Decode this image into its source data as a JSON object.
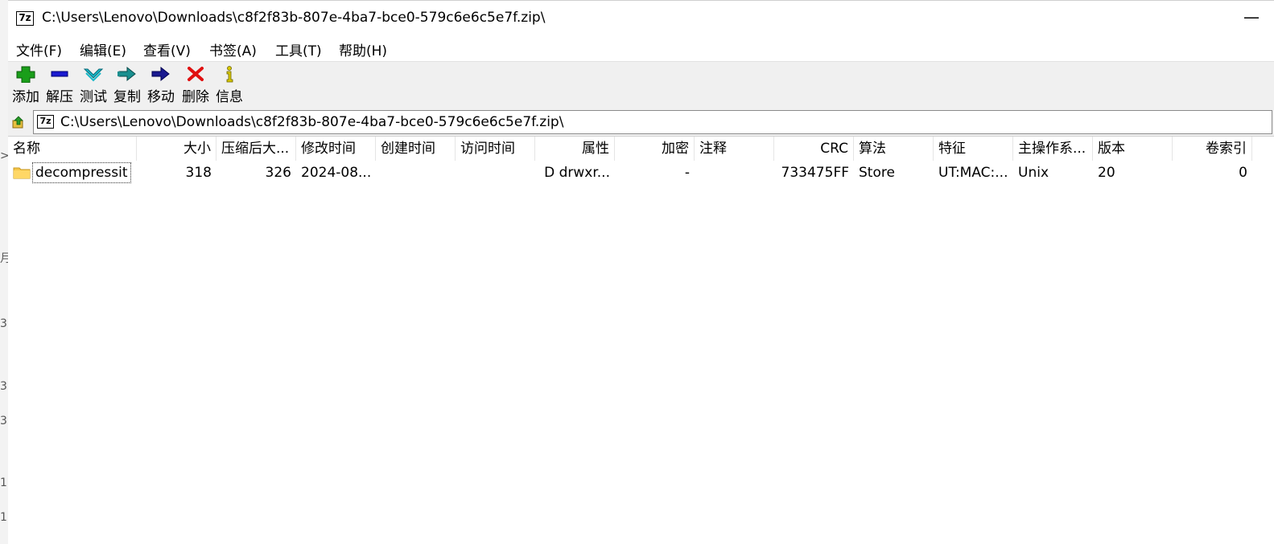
{
  "window": {
    "title": "C:\\Users\\Lenovo\\Downloads\\c8f2f83b-807e-4ba7-bce0-579c6e6c5e7f.zip\\",
    "app_icon_text": "7z",
    "minimize_glyph": "—"
  },
  "menu": [
    "文件(F)",
    "编辑(E)",
    "查看(V)",
    "书签(A)",
    "工具(T)",
    "帮助(H)"
  ],
  "toolbar": [
    {
      "label": "添加",
      "icon": "add-icon",
      "color": "#1a9e1a"
    },
    {
      "label": "解压",
      "icon": "extract-icon",
      "color": "#1a1ad0"
    },
    {
      "label": "测试",
      "icon": "test-icon",
      "color": "#18b8c8"
    },
    {
      "label": "复制",
      "icon": "copy-icon",
      "color": "#1a8f8f"
    },
    {
      "label": "移动",
      "icon": "move-icon",
      "color": "#1a1a90"
    },
    {
      "label": "删除",
      "icon": "delete-icon",
      "color": "#e01010"
    },
    {
      "label": "信息",
      "icon": "info-icon",
      "color": "#d8c800"
    }
  ],
  "address": {
    "path": "C:\\Users\\Lenovo\\Downloads\\c8f2f83b-807e-4ba7-bce0-579c6e6c5e7f.zip\\"
  },
  "columns": [
    "名称",
    "大小",
    "压缩后大...",
    "修改时间",
    "创建时间",
    "访问时间",
    "属性",
    "加密",
    "注释",
    "CRC",
    "算法",
    "特征",
    "主操作系...",
    "版本",
    "卷索引"
  ],
  "rows": [
    {
      "name": "decompressit",
      "size": "318",
      "packed": "326",
      "modified": "2024-08...",
      "created": "",
      "accessed": "",
      "attributes": "D drwxr...",
      "encrypted": "-",
      "comment": "",
      "crc": "733475FF",
      "method": "Store",
      "characteristics": "UT:MAC:...",
      "host_os": "Unix",
      "version": "20",
      "volume_index": "0"
    }
  ],
  "background_glyphs": [
    ">",
    "月",
    "3",
    "3",
    "3",
    "1",
    "1"
  ]
}
